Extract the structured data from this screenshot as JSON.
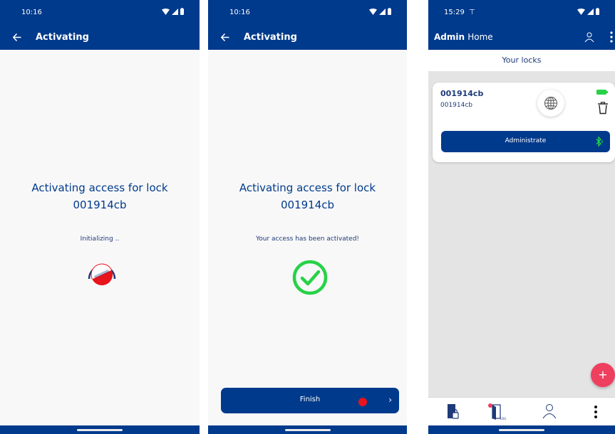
{
  "colors": {
    "primary": "#003a8c",
    "text": "#1e3a78",
    "success": "#27d247",
    "danger": "#e8141b",
    "accent": "#ef3f5f",
    "background": "#f8f8f8",
    "list_background": "#e4e4e4"
  },
  "screens": [
    {
      "status_bar": {
        "time": "10:16",
        "icons": [
          "wifi-icon",
          "signal-icon",
          "battery-icon"
        ]
      },
      "app_bar": {
        "title": "Activating",
        "back_icon": "arrow-left-icon"
      },
      "heading_line1": "Activating access for lock",
      "heading_line2": "001914cb",
      "status": "Initializing ..",
      "spinner_icon": "loading-spinner-icon"
    },
    {
      "status_bar": {
        "time": "10:16",
        "icons": [
          "wifi-icon",
          "signal-icon",
          "battery-icon"
        ]
      },
      "app_bar": {
        "title": "Activating",
        "back_icon": "arrow-left-icon"
      },
      "heading_line1": "Activating access for lock",
      "heading_line2": "001914cb",
      "status": "Your access has been activated!",
      "success_icon": "check-circle-icon",
      "finish_button": {
        "label": "Finish",
        "chevron": "›",
        "indicator_icon": "red-dot-icon"
      }
    },
    {
      "status_bar": {
        "time": "15:29",
        "extra": "⊤",
        "icons": [
          "wifi-icon",
          "signal-icon",
          "battery-icon"
        ]
      },
      "app_bar": {
        "title_bold": "Admin",
        "title_rest": "Home",
        "icons": [
          "person-icon",
          "more-vertical-icon"
        ]
      },
      "section_title": "Your locks",
      "lock_card": {
        "name": "001914cb",
        "id": "001914cb",
        "icons": [
          "globe-icon",
          "battery-full-icon",
          "trash-icon"
        ],
        "button_label": "Administrate",
        "button_icon": "bluetooth-icon"
      },
      "fab_label": "+",
      "bottom_nav": {
        "items": [
          {
            "icon": "door-lock-icon"
          },
          {
            "icon": "door-log-icon",
            "label": "LOG"
          },
          {
            "icon": "person-icon"
          },
          {
            "icon": "more-vertical-icon"
          }
        ]
      }
    }
  ]
}
